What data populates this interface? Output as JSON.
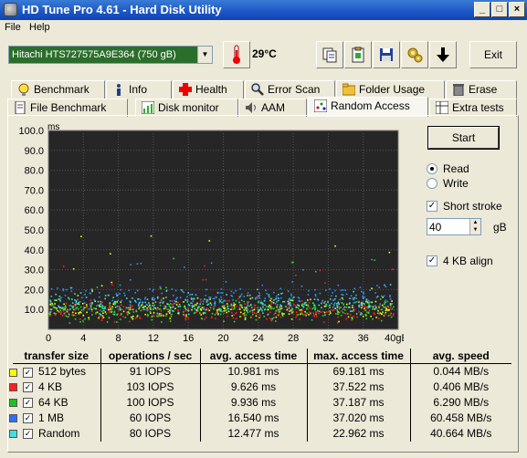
{
  "window": {
    "title": "HD Tune Pro 4.61 - Hard Disk Utility"
  },
  "menu": {
    "file": "File",
    "help": "Help"
  },
  "toolbar": {
    "drive": "Hitachi HTS727575A9E364 (750 gB)",
    "temperature": "29°C",
    "exit_label": "Exit"
  },
  "tabs_top": [
    {
      "label": "Benchmark",
      "icon": "lightbulb-icon"
    },
    {
      "label": "Info",
      "icon": "info-icon"
    },
    {
      "label": "Health",
      "icon": "health-cross-icon"
    },
    {
      "label": "Error Scan",
      "icon": "magnifier-icon"
    },
    {
      "label": "Folder Usage",
      "icon": "folder-icon"
    },
    {
      "label": "Erase",
      "icon": "trash-icon"
    }
  ],
  "tabs_bottom": [
    {
      "label": "File Benchmark",
      "icon": "document-icon"
    },
    {
      "label": "Disk monitor",
      "icon": "chart-icon"
    },
    {
      "label": "AAM",
      "icon": "speaker-icon"
    },
    {
      "label": "Random Access",
      "icon": "random-access-icon",
      "active": true
    },
    {
      "label": "Extra tests",
      "icon": "table-icon"
    }
  ],
  "controls": {
    "start_label": "Start",
    "read_label": "Read",
    "write_label": "Write",
    "mode": "Read",
    "short_stroke_label": "Short stroke",
    "short_stroke": true,
    "stroke_value": "40",
    "stroke_unit": "gB",
    "align_label": "4 KB align",
    "align": true
  },
  "chart_data": {
    "type": "scatter",
    "ylabel": "ms",
    "xlabel": "",
    "y_ticks": [
      "100.0",
      "90.0",
      "80.0",
      "70.0",
      "60.0",
      "50.0",
      "40.0",
      "30.0",
      "20.0",
      "10.0"
    ],
    "x_ticks": [
      "0",
      "4",
      "8",
      "12",
      "16",
      "20",
      "24",
      "28",
      "32",
      "36",
      "40gB"
    ],
    "xlim": [
      0,
      40
    ],
    "ylim": [
      0,
      100
    ],
    "grid": true,
    "background": "#262626",
    "series": [
      {
        "name": "512 bytes",
        "color": "#ffff00",
        "mean_ms": 10.981,
        "max_ms": 69.181
      },
      {
        "name": "4 KB",
        "color": "#ff2020",
        "mean_ms": 9.626,
        "max_ms": 37.522
      },
      {
        "name": "64 KB",
        "color": "#20e020",
        "mean_ms": 9.936,
        "max_ms": 37.187
      },
      {
        "name": "1 MB",
        "color": "#3090ff",
        "mean_ms": 16.54,
        "max_ms": 37.02
      },
      {
        "name": "Random",
        "color": "#40e0e0",
        "mean_ms": 12.477,
        "max_ms": 22.962
      }
    ]
  },
  "results": {
    "headers": [
      "transfer size",
      "operations / sec",
      "avg. access time",
      "max. access time",
      "avg. speed"
    ],
    "rows": [
      {
        "color": "#ffff00",
        "name": "512 bytes",
        "ops": "91 IOPS",
        "avg": "10.981 ms",
        "max": "69.181 ms",
        "speed": "0.044 MB/s"
      },
      {
        "color": "#ff2020",
        "name": "4 KB",
        "ops": "103 IOPS",
        "avg": "9.626 ms",
        "max": "37.522 ms",
        "speed": "0.406 MB/s"
      },
      {
        "color": "#20c020",
        "name": "64 KB",
        "ops": "100 IOPS",
        "avg": "9.936 ms",
        "max": "37.187 ms",
        "speed": "6.290 MB/s"
      },
      {
        "color": "#3070ff",
        "name": "1 MB",
        "ops": "60 IOPS",
        "avg": "16.540 ms",
        "max": "37.020 ms",
        "speed": "60.458 MB/s"
      },
      {
        "color": "#40e0e0",
        "name": "Random",
        "ops": "80 IOPS",
        "avg": "12.477 ms",
        "max": "22.962 ms",
        "speed": "40.664 MB/s"
      }
    ]
  }
}
